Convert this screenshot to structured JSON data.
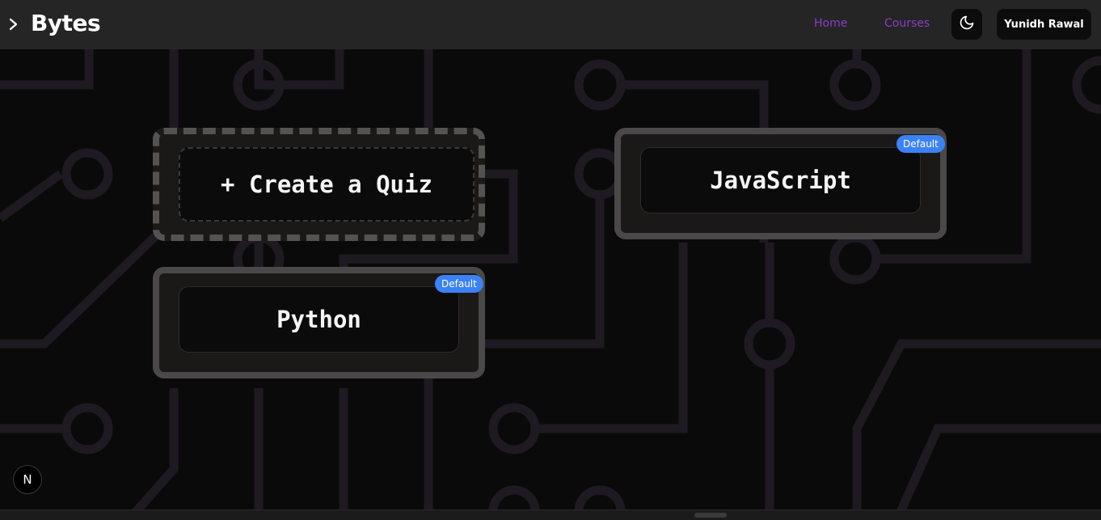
{
  "header": {
    "brand": "Bytes",
    "nav": {
      "home": "Home",
      "courses": "Courses"
    },
    "user_name": "Yunidh Rawal",
    "icons": {
      "toggle": "chevron-right-icon",
      "theme": "moon-icon"
    }
  },
  "quizzes": {
    "create_label": "+ Create a Quiz",
    "items": [
      {
        "name": "JavaScript",
        "badge": "Default"
      },
      {
        "name": "Python",
        "badge": "Default"
      }
    ]
  },
  "dev_indicator": "N",
  "colors": {
    "accent": "#8b3cc7",
    "badge": "#3b82f6",
    "header": "#252525",
    "background": "#0b0a0a"
  }
}
